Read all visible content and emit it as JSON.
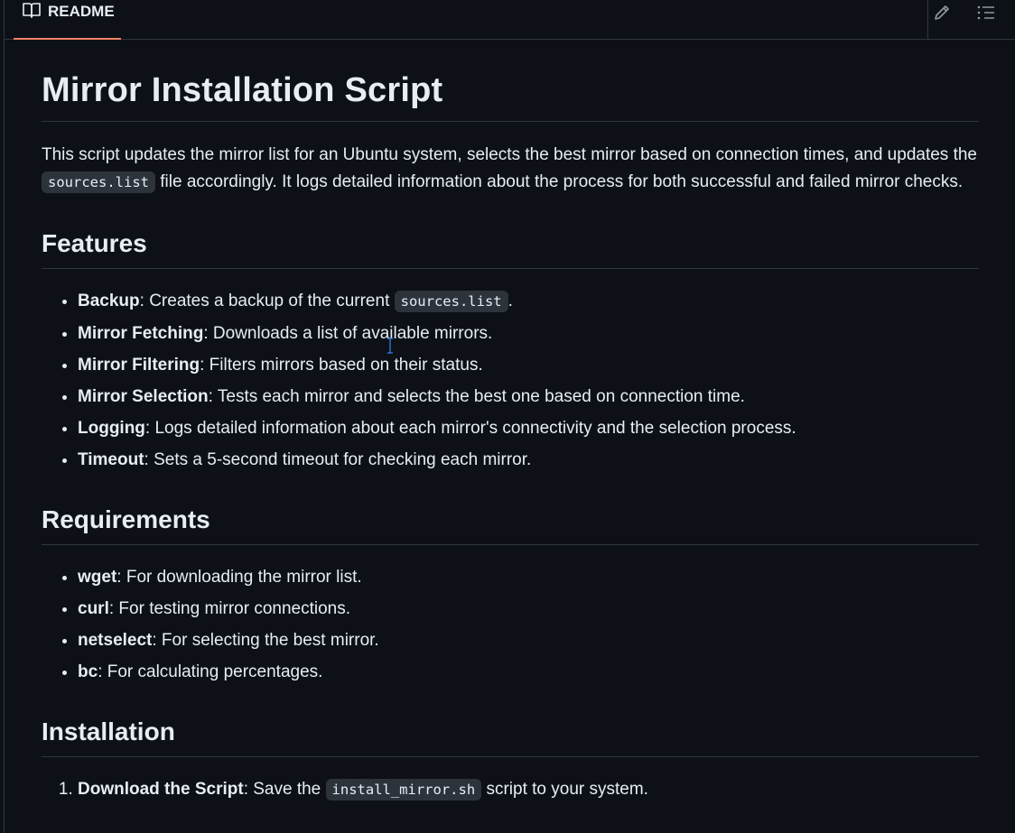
{
  "tab": {
    "label": "README",
    "icon": "book-icon"
  },
  "toolbar": {
    "edit_icon": "pencil-icon",
    "outline_icon": "list-icon"
  },
  "readme": {
    "title": "Mirror Installation Script",
    "intro_part1": "This script updates the mirror list for an Ubuntu system, selects the best mirror based on connection times, and updates the ",
    "intro_code": "sources.list",
    "intro_part2": " file accordingly. It logs detailed information about the process for both successful and failed mirror checks.",
    "features": {
      "heading": "Features",
      "items": [
        {
          "term": "Backup",
          "text": ": Creates a backup of the current ",
          "code": "sources.list",
          "tail": "."
        },
        {
          "term": "Mirror Fetching",
          "text": ": Downloads a list of available mirrors."
        },
        {
          "term": "Mirror Filtering",
          "text": ": Filters mirrors based on their status."
        },
        {
          "term": "Mirror Selection",
          "text": ": Tests each mirror and selects the best one based on connection time."
        },
        {
          "term": "Logging",
          "text": ": Logs detailed information about each mirror's connectivity and the selection process."
        },
        {
          "term": "Timeout",
          "text": ": Sets a 5-second timeout for checking each mirror."
        }
      ]
    },
    "requirements": {
      "heading": "Requirements",
      "items": [
        {
          "term": "wget",
          "text": ": For downloading the mirror list."
        },
        {
          "term": "curl",
          "text": ": For testing mirror connections."
        },
        {
          "term": "netselect",
          "text": ": For selecting the best mirror."
        },
        {
          "term": "bc",
          "text": ": For calculating percentages."
        }
      ]
    },
    "installation": {
      "heading": "Installation",
      "steps": [
        {
          "term": "Download the Script",
          "text": ": Save the ",
          "code": "install_mirror.sh",
          "tail": " script to your system."
        }
      ]
    }
  },
  "colors": {
    "background": "#0d1117",
    "border": "#30363d",
    "tab_accent": "#f78166",
    "text": "#e6edf3",
    "code_bg": "#2d333b"
  }
}
